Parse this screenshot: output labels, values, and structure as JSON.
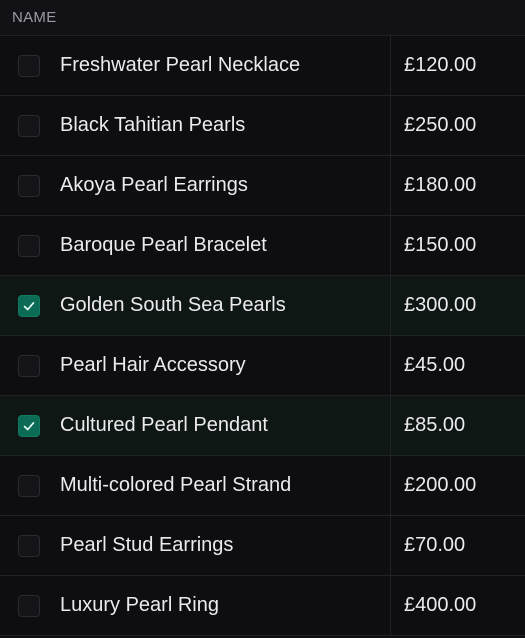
{
  "table": {
    "header": {
      "name_label": "NAME"
    },
    "rows": [
      {
        "name": "Freshwater Pearl Necklace",
        "price": "£120.00",
        "checked": false
      },
      {
        "name": "Black Tahitian Pearls",
        "price": "£250.00",
        "checked": false
      },
      {
        "name": "Akoya Pearl Earrings",
        "price": "£180.00",
        "checked": false
      },
      {
        "name": "Baroque Pearl Bracelet",
        "price": "£150.00",
        "checked": false
      },
      {
        "name": "Golden South Sea Pearls",
        "price": "£300.00",
        "checked": true
      },
      {
        "name": "Pearl Hair Accessory",
        "price": "£45.00",
        "checked": false
      },
      {
        "name": "Cultured Pearl Pendant",
        "price": "£85.00",
        "checked": true
      },
      {
        "name": "Multi-colored Pearl Strand",
        "price": "£200.00",
        "checked": false
      },
      {
        "name": "Pearl Stud Earrings",
        "price": "£70.00",
        "checked": false
      },
      {
        "name": "Luxury Pearl Ring",
        "price": "£400.00",
        "checked": false
      }
    ]
  },
  "colors": {
    "checked_bg": "#0c6b55",
    "selected_row_bg": "#0f1715"
  },
  "icons": {
    "check": "check-icon"
  }
}
